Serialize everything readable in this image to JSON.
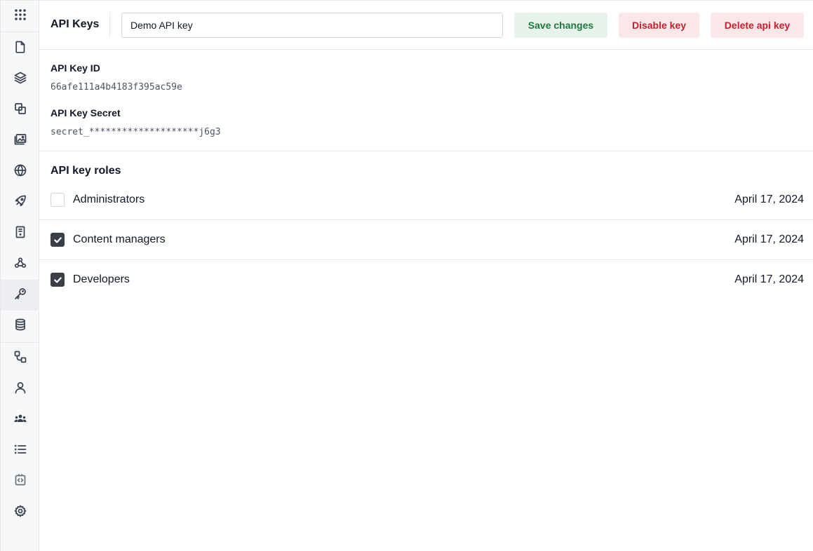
{
  "sidebar": {
    "items": [
      {
        "icon": "grid-icon"
      },
      {
        "icon": "file-icon"
      },
      {
        "icon": "layers-icon"
      },
      {
        "icon": "copy-icon"
      },
      {
        "icon": "images-icon"
      },
      {
        "icon": "globe-icon"
      },
      {
        "icon": "rocket-icon"
      },
      {
        "icon": "document-icon"
      },
      {
        "icon": "webhook-icon"
      },
      {
        "icon": "key-icon",
        "active": true
      },
      {
        "icon": "database-icon"
      },
      {
        "icon": "workflow-icon"
      },
      {
        "icon": "user-icon"
      },
      {
        "icon": "users-icon"
      },
      {
        "icon": "list-icon"
      },
      {
        "icon": "code-icon"
      },
      {
        "icon": "gear-icon"
      }
    ]
  },
  "header": {
    "title": "API Keys",
    "name_value": "Demo API key",
    "save_label": "Save changes",
    "disable_label": "Disable key",
    "delete_label": "Delete api key"
  },
  "details": {
    "id_label": "API Key ID",
    "id_value": "66afe111a4b4183f395ac59e",
    "secret_label": "API Key Secret",
    "secret_value": "secret_********************j6g3"
  },
  "roles": {
    "title": "API key roles",
    "items": [
      {
        "name": "Administrators",
        "date": "April 17, 2024",
        "checked": false
      },
      {
        "name": "Content managers",
        "date": "April 17, 2024",
        "checked": true
      },
      {
        "name": "Developers",
        "date": "April 17, 2024",
        "checked": true
      }
    ]
  },
  "colors": {
    "save": "#1c7a3e",
    "danger": "#c0202f",
    "checked": "#3a3f47"
  }
}
